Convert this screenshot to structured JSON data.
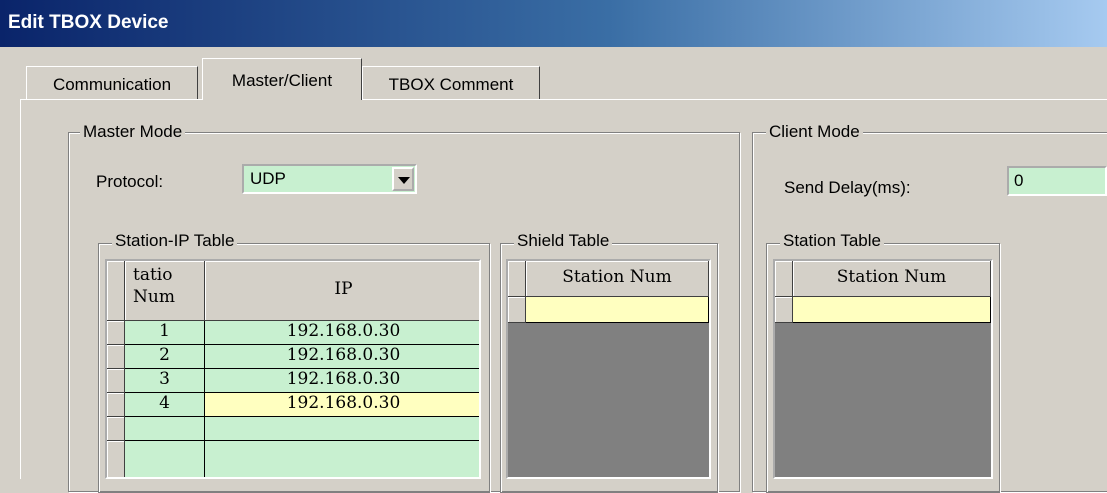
{
  "window": {
    "title": "Edit TBOX Device"
  },
  "tabs": [
    {
      "label": "Communication"
    },
    {
      "label": "Master/Client"
    },
    {
      "label": "TBOX Comment"
    }
  ],
  "master": {
    "group_label": "Master Mode",
    "protocol_label": "Protocol:",
    "protocol_value": "UDP",
    "station_ip_table": {
      "label": "Station-IP Table",
      "col_station_line1": "tatio",
      "col_station_line2": "Num",
      "col_ip": "IP",
      "rows": [
        {
          "station": "1",
          "ip": "192.168.0.30"
        },
        {
          "station": "2",
          "ip": "192.168.0.30"
        },
        {
          "station": "3",
          "ip": "192.168.0.30"
        },
        {
          "station": "4",
          "ip": "192.168.0.30"
        }
      ]
    },
    "shield_table": {
      "label": "Shield Table",
      "col_station": "Station Num"
    }
  },
  "client": {
    "group_label": "Client Mode",
    "send_delay_label": "Send Delay(ms):",
    "send_delay_value": "0",
    "station_table": {
      "label": "Station Table",
      "col_station": "Station Num"
    }
  }
}
